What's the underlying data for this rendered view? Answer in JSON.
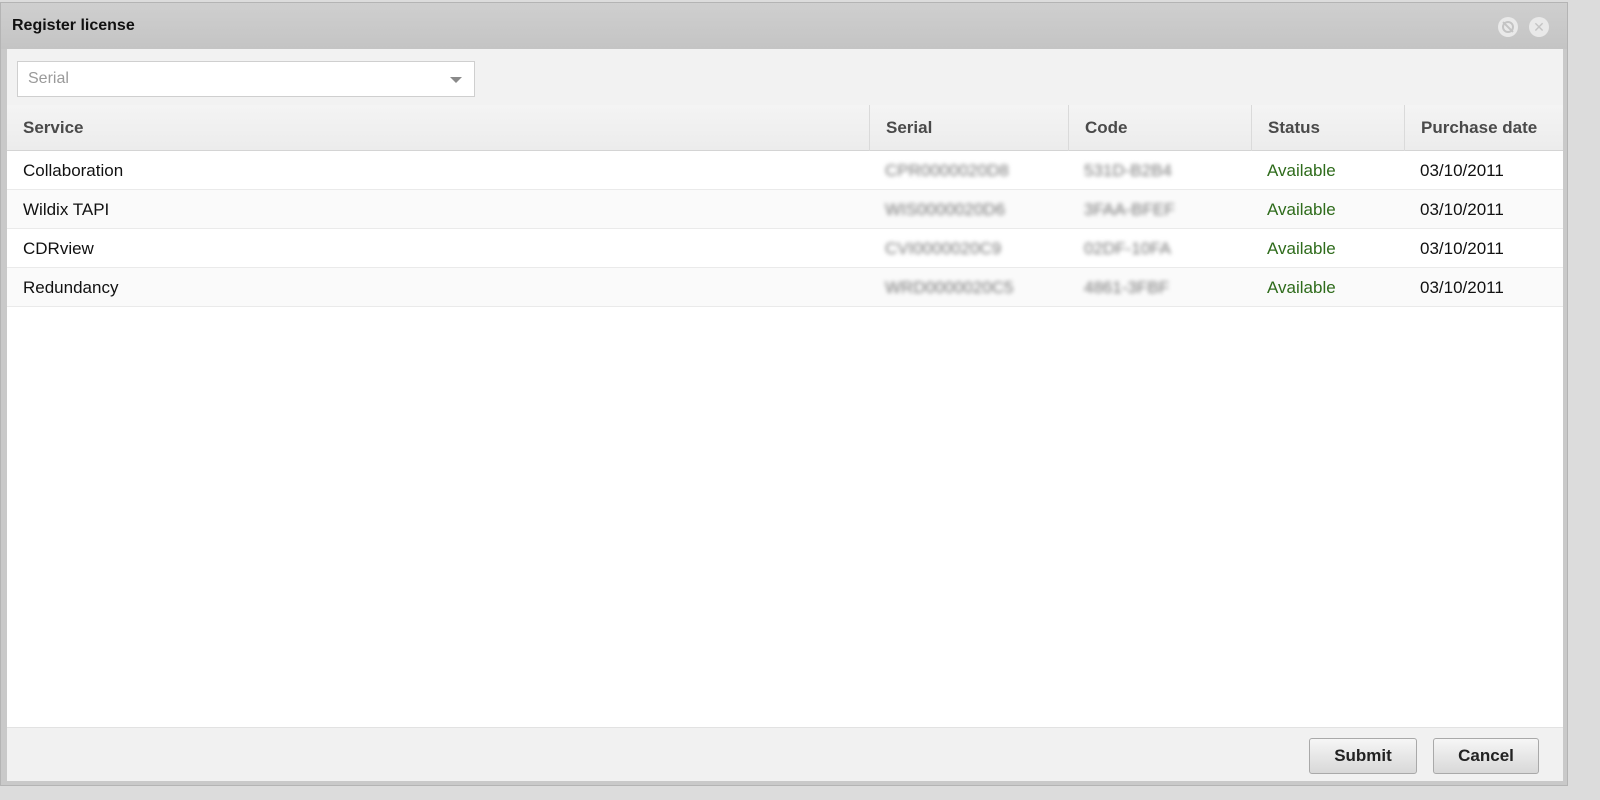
{
  "dialog": {
    "title": "Register license",
    "collapse_glyph": "",
    "close_glyph": "✕"
  },
  "filter": {
    "value": "Serial"
  },
  "grid": {
    "columns": [
      "Service",
      "Serial",
      "Code",
      "Status",
      "Purchase date"
    ],
    "rows": [
      {
        "service": "Collaboration",
        "serial": "CPR0000020D8",
        "code": "531D-B2B4",
        "status": "Available",
        "date": "03/10/2011"
      },
      {
        "service": "Wildix TAPI",
        "serial": "WIS0000020D6",
        "code": "3FAA-BFEF",
        "status": "Available",
        "date": "03/10/2011"
      },
      {
        "service": "CDRview",
        "serial": "CVI0000020C9",
        "code": "02DF-10FA",
        "status": "Available",
        "date": "03/10/2011"
      },
      {
        "service": "Redundancy",
        "serial": "WRD0000020C5",
        "code": "4861-3FBF",
        "status": "Available",
        "date": "03/10/2011"
      }
    ]
  },
  "footer": {
    "submit_label": "Submit",
    "cancel_label": "Cancel"
  },
  "colors": {
    "status_available": "#2e6b1b",
    "titlebar": "#c9c9c9"
  }
}
